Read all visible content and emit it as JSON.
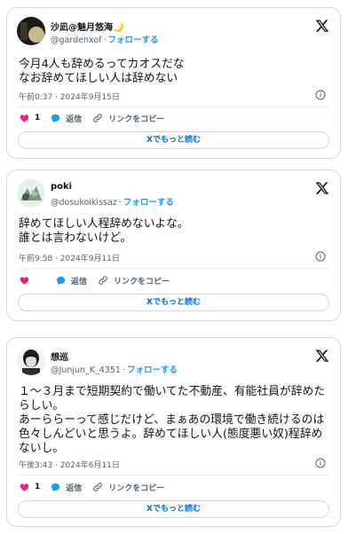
{
  "x_label": "X",
  "tweets": [
    {
      "name": "沙凪@魅月悠海",
      "name_emoji": "🌙",
      "handle": "@gardenxof",
      "follow": "フォローする",
      "text": "今月4人も辞めるってカオスだな\nなお辞めてほしい人は辞めない",
      "datetime": "午前0:37 · 2024年9月15日",
      "likes": "1",
      "reply": "返信",
      "copy": "リンクをコピー",
      "readmore": "Xでもっと読む",
      "avatar_colors": [
        "#1d1a14",
        "#c8b88a"
      ]
    },
    {
      "name": "poki",
      "name_emoji": "",
      "handle": "@dosukoikissaz",
      "follow": "フォローする",
      "text": "辞めてほしい人程辞めないよな。\n誰とは言わないけど。",
      "datetime": "午前9:58 · 2024年9月11日",
      "likes": "",
      "reply": "返信",
      "copy": "リンクをコピー",
      "readmore": "Xでもっと読む",
      "avatar_colors": [
        "#e8efe8",
        "#7a9a80"
      ]
    },
    {
      "name": "想巡",
      "name_emoji": "",
      "handle": "@Junjun_K_4351",
      "follow": "フォローする",
      "text": "１～３月まで短期契約で働いてた不動産、有能社員が辞めたらしい。\nあーららーって感じだけど、まぁあの環境で働き続けるのは色々しんどいと思うよ。辞めてほしい人(態度悪い奴)程辞めないし。",
      "datetime": "午後3:43 · 2024年6月11日",
      "likes": "1",
      "reply": "返信",
      "copy": "リンクをコピー",
      "readmore": "Xでもっと読む",
      "avatar_colors": [
        "#1a1c24",
        "#f2f2f2"
      ]
    }
  ],
  "colors": {
    "like": "#f91880",
    "reply": "#1d9bf0",
    "follow": "#1d9bf0",
    "readmore": "#006fd6"
  }
}
